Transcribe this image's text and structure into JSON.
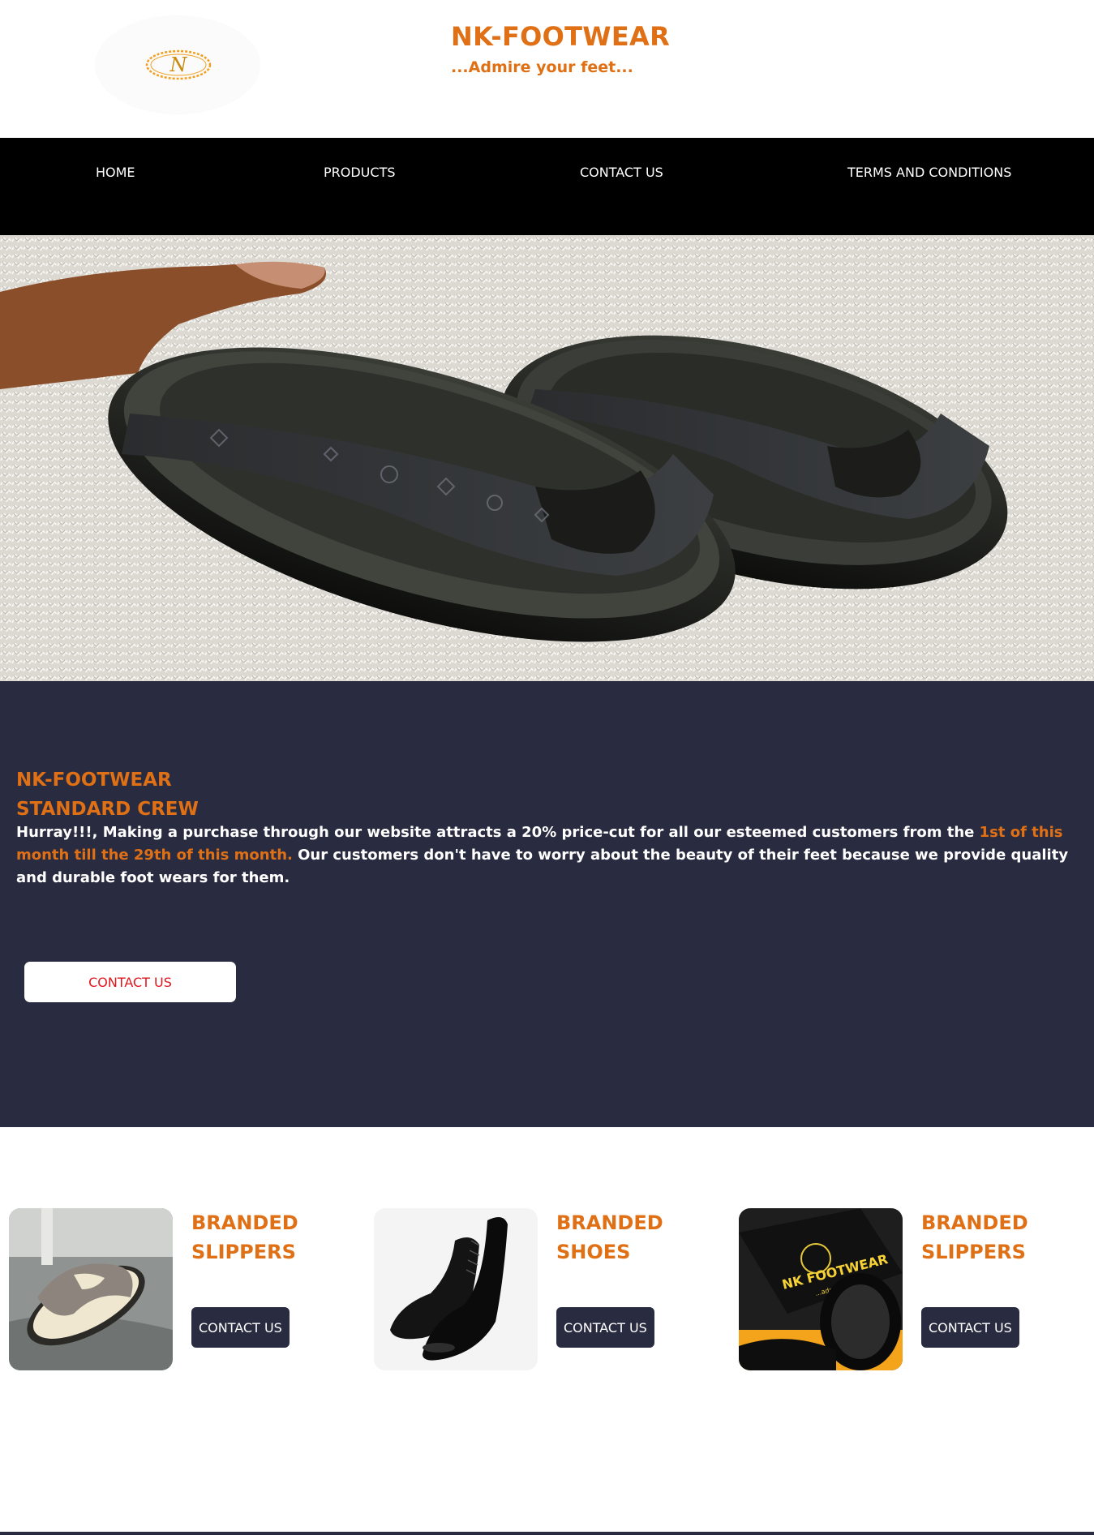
{
  "header": {
    "brand_title": "NK-FOOTWEAR",
    "tagline": "...Admire your feet...",
    "logo_letter": "N"
  },
  "nav": {
    "items": [
      {
        "label": "HOME"
      },
      {
        "label": "PRODUCTS"
      },
      {
        "label": "CONTACT US"
      },
      {
        "label": "TERMS AND CONDITIONS"
      }
    ]
  },
  "promo": {
    "title_line1": "NK-FOOTWEAR",
    "title_line2": "STANDARD CREW",
    "text_part1": "Hurray!!!, Making a purchase through our website attracts a 20% price-cut for all our esteemed customers from the ",
    "text_highlight": "1st of this month till the 29th of this month.",
    "text_part2": " Our customers don't have to worry about the beauty of their feet because we provide quality and durable foot wears for them.",
    "button_label": "CONTACT US"
  },
  "products": [
    {
      "name_line1": "BRANDED",
      "name_line2": "SLIPPERS",
      "button_label": "CONTACT US",
      "image": "suede-slippers"
    },
    {
      "name_line1": "BRANDED",
      "name_line2": "SHOES",
      "button_label": "CONTACT US",
      "image": "black-oxford-shoes"
    },
    {
      "name_line1": "BRANDED",
      "name_line2": "SLIPPERS",
      "button_label": "CONTACT US",
      "image": "boxed-slippers",
      "box_text": "NK FOOTWEAR",
      "box_subtext": "...admire your feet"
    }
  ],
  "colors": {
    "accent": "#e07015",
    "dark_panel": "#292c40",
    "nav_bg": "#000000",
    "promo_button_text": "#e0161e"
  }
}
